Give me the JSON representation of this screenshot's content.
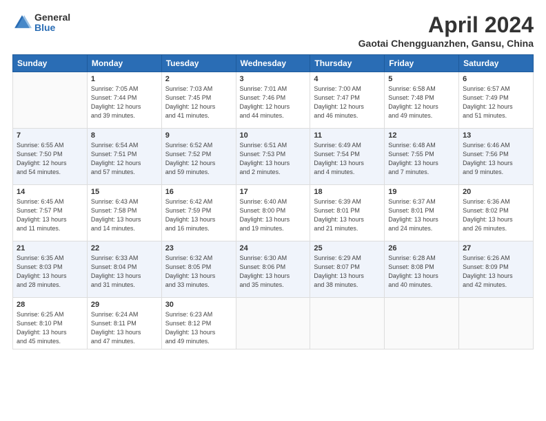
{
  "header": {
    "logo_general": "General",
    "logo_blue": "Blue",
    "month_title": "April 2024",
    "location": "Gaotai Chengguanzhen, Gansu, China"
  },
  "days_of_week": [
    "Sunday",
    "Monday",
    "Tuesday",
    "Wednesday",
    "Thursday",
    "Friday",
    "Saturday"
  ],
  "weeks": [
    [
      {
        "num": "",
        "info": ""
      },
      {
        "num": "1",
        "info": "Sunrise: 7:05 AM\nSunset: 7:44 PM\nDaylight: 12 hours\nand 39 minutes."
      },
      {
        "num": "2",
        "info": "Sunrise: 7:03 AM\nSunset: 7:45 PM\nDaylight: 12 hours\nand 41 minutes."
      },
      {
        "num": "3",
        "info": "Sunrise: 7:01 AM\nSunset: 7:46 PM\nDaylight: 12 hours\nand 44 minutes."
      },
      {
        "num": "4",
        "info": "Sunrise: 7:00 AM\nSunset: 7:47 PM\nDaylight: 12 hours\nand 46 minutes."
      },
      {
        "num": "5",
        "info": "Sunrise: 6:58 AM\nSunset: 7:48 PM\nDaylight: 12 hours\nand 49 minutes."
      },
      {
        "num": "6",
        "info": "Sunrise: 6:57 AM\nSunset: 7:49 PM\nDaylight: 12 hours\nand 51 minutes."
      }
    ],
    [
      {
        "num": "7",
        "info": "Sunrise: 6:55 AM\nSunset: 7:50 PM\nDaylight: 12 hours\nand 54 minutes."
      },
      {
        "num": "8",
        "info": "Sunrise: 6:54 AM\nSunset: 7:51 PM\nDaylight: 12 hours\nand 57 minutes."
      },
      {
        "num": "9",
        "info": "Sunrise: 6:52 AM\nSunset: 7:52 PM\nDaylight: 12 hours\nand 59 minutes."
      },
      {
        "num": "10",
        "info": "Sunrise: 6:51 AM\nSunset: 7:53 PM\nDaylight: 13 hours\nand 2 minutes."
      },
      {
        "num": "11",
        "info": "Sunrise: 6:49 AM\nSunset: 7:54 PM\nDaylight: 13 hours\nand 4 minutes."
      },
      {
        "num": "12",
        "info": "Sunrise: 6:48 AM\nSunset: 7:55 PM\nDaylight: 13 hours\nand 7 minutes."
      },
      {
        "num": "13",
        "info": "Sunrise: 6:46 AM\nSunset: 7:56 PM\nDaylight: 13 hours\nand 9 minutes."
      }
    ],
    [
      {
        "num": "14",
        "info": "Sunrise: 6:45 AM\nSunset: 7:57 PM\nDaylight: 13 hours\nand 11 minutes."
      },
      {
        "num": "15",
        "info": "Sunrise: 6:43 AM\nSunset: 7:58 PM\nDaylight: 13 hours\nand 14 minutes."
      },
      {
        "num": "16",
        "info": "Sunrise: 6:42 AM\nSunset: 7:59 PM\nDaylight: 13 hours\nand 16 minutes."
      },
      {
        "num": "17",
        "info": "Sunrise: 6:40 AM\nSunset: 8:00 PM\nDaylight: 13 hours\nand 19 minutes."
      },
      {
        "num": "18",
        "info": "Sunrise: 6:39 AM\nSunset: 8:01 PM\nDaylight: 13 hours\nand 21 minutes."
      },
      {
        "num": "19",
        "info": "Sunrise: 6:37 AM\nSunset: 8:01 PM\nDaylight: 13 hours\nand 24 minutes."
      },
      {
        "num": "20",
        "info": "Sunrise: 6:36 AM\nSunset: 8:02 PM\nDaylight: 13 hours\nand 26 minutes."
      }
    ],
    [
      {
        "num": "21",
        "info": "Sunrise: 6:35 AM\nSunset: 8:03 PM\nDaylight: 13 hours\nand 28 minutes."
      },
      {
        "num": "22",
        "info": "Sunrise: 6:33 AM\nSunset: 8:04 PM\nDaylight: 13 hours\nand 31 minutes."
      },
      {
        "num": "23",
        "info": "Sunrise: 6:32 AM\nSunset: 8:05 PM\nDaylight: 13 hours\nand 33 minutes."
      },
      {
        "num": "24",
        "info": "Sunrise: 6:30 AM\nSunset: 8:06 PM\nDaylight: 13 hours\nand 35 minutes."
      },
      {
        "num": "25",
        "info": "Sunrise: 6:29 AM\nSunset: 8:07 PM\nDaylight: 13 hours\nand 38 minutes."
      },
      {
        "num": "26",
        "info": "Sunrise: 6:28 AM\nSunset: 8:08 PM\nDaylight: 13 hours\nand 40 minutes."
      },
      {
        "num": "27",
        "info": "Sunrise: 6:26 AM\nSunset: 8:09 PM\nDaylight: 13 hours\nand 42 minutes."
      }
    ],
    [
      {
        "num": "28",
        "info": "Sunrise: 6:25 AM\nSunset: 8:10 PM\nDaylight: 13 hours\nand 45 minutes."
      },
      {
        "num": "29",
        "info": "Sunrise: 6:24 AM\nSunset: 8:11 PM\nDaylight: 13 hours\nand 47 minutes."
      },
      {
        "num": "30",
        "info": "Sunrise: 6:23 AM\nSunset: 8:12 PM\nDaylight: 13 hours\nand 49 minutes."
      },
      {
        "num": "",
        "info": ""
      },
      {
        "num": "",
        "info": ""
      },
      {
        "num": "",
        "info": ""
      },
      {
        "num": "",
        "info": ""
      }
    ]
  ]
}
